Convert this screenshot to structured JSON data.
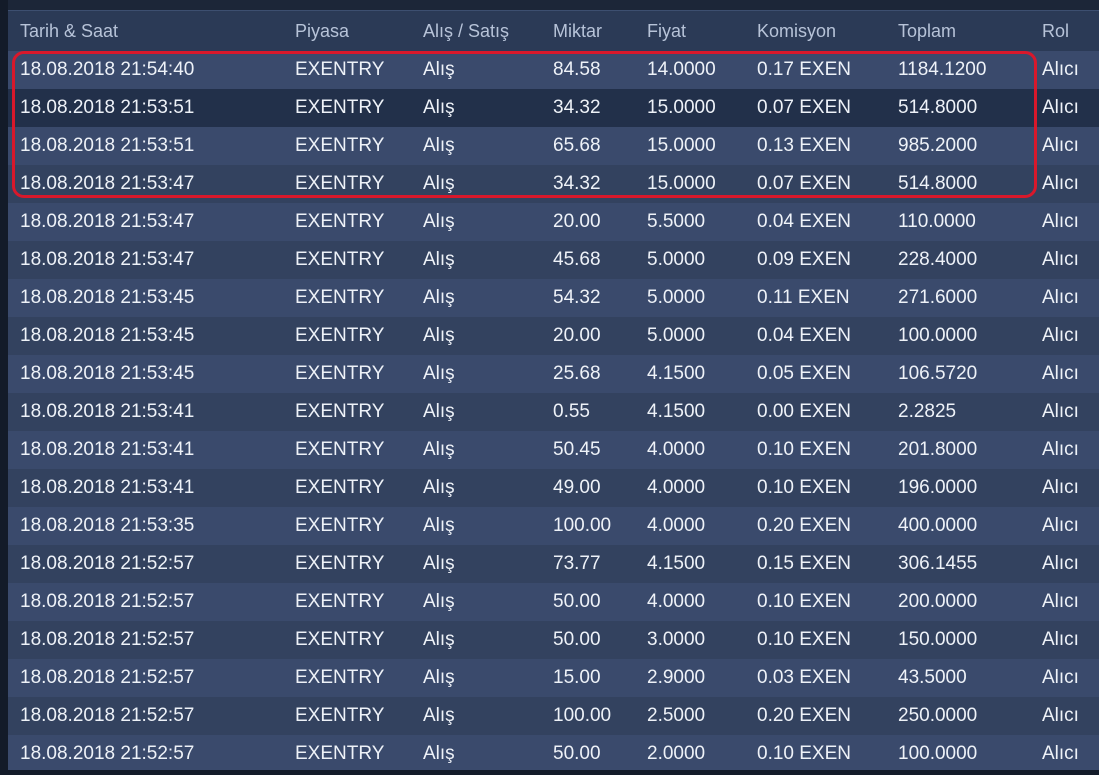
{
  "table": {
    "headers": {
      "date": "Tarih & Saat",
      "market": "Piyasa",
      "side": "Alış / Satış",
      "amount": "Miktar",
      "price": "Fiyat",
      "fee": "Komisyon",
      "total": "Toplam",
      "role": "Rol"
    },
    "rows": [
      {
        "date": "18.08.2018 21:54:40",
        "market": "EXENTRY",
        "side": "Alış",
        "amount": "84.58",
        "price": "14.0000",
        "fee": "0.17 EXEN",
        "total": "1184.1200",
        "role": "Alıcı"
      },
      {
        "date": "18.08.2018 21:53:51",
        "market": "EXENTRY",
        "side": "Alış",
        "amount": "34.32",
        "price": "15.0000",
        "fee": "0.07 EXEN",
        "total": "514.8000",
        "role": "Alıcı"
      },
      {
        "date": "18.08.2018 21:53:51",
        "market": "EXENTRY",
        "side": "Alış",
        "amount": "65.68",
        "price": "15.0000",
        "fee": "0.13 EXEN",
        "total": "985.2000",
        "role": "Alıcı"
      },
      {
        "date": "18.08.2018 21:53:47",
        "market": "EXENTRY",
        "side": "Alış",
        "amount": "34.32",
        "price": "15.0000",
        "fee": "0.07 EXEN",
        "total": "514.8000",
        "role": "Alıcı"
      },
      {
        "date": "18.08.2018 21:53:47",
        "market": "EXENTRY",
        "side": "Alış",
        "amount": "20.00",
        "price": "5.5000",
        "fee": "0.04 EXEN",
        "total": "110.0000",
        "role": "Alıcı"
      },
      {
        "date": "18.08.2018 21:53:47",
        "market": "EXENTRY",
        "side": "Alış",
        "amount": "45.68",
        "price": "5.0000",
        "fee": "0.09 EXEN",
        "total": "228.4000",
        "role": "Alıcı"
      },
      {
        "date": "18.08.2018 21:53:45",
        "market": "EXENTRY",
        "side": "Alış",
        "amount": "54.32",
        "price": "5.0000",
        "fee": "0.11 EXEN",
        "total": "271.6000",
        "role": "Alıcı"
      },
      {
        "date": "18.08.2018 21:53:45",
        "market": "EXENTRY",
        "side": "Alış",
        "amount": "20.00",
        "price": "5.0000",
        "fee": "0.04 EXEN",
        "total": "100.0000",
        "role": "Alıcı"
      },
      {
        "date": "18.08.2018 21:53:45",
        "market": "EXENTRY",
        "side": "Alış",
        "amount": "25.68",
        "price": "4.1500",
        "fee": "0.05 EXEN",
        "total": "106.5720",
        "role": "Alıcı"
      },
      {
        "date": "18.08.2018 21:53:41",
        "market": "EXENTRY",
        "side": "Alış",
        "amount": "0.55",
        "price": "4.1500",
        "fee": "0.00 EXEN",
        "total": "2.2825",
        "role": "Alıcı"
      },
      {
        "date": "18.08.2018 21:53:41",
        "market": "EXENTRY",
        "side": "Alış",
        "amount": "50.45",
        "price": "4.0000",
        "fee": "0.10 EXEN",
        "total": "201.8000",
        "role": "Alıcı"
      },
      {
        "date": "18.08.2018 21:53:41",
        "market": "EXENTRY",
        "side": "Alış",
        "amount": "49.00",
        "price": "4.0000",
        "fee": "0.10 EXEN",
        "total": "196.0000",
        "role": "Alıcı"
      },
      {
        "date": "18.08.2018 21:53:35",
        "market": "EXENTRY",
        "side": "Alış",
        "amount": "100.00",
        "price": "4.0000",
        "fee": "0.20 EXEN",
        "total": "400.0000",
        "role": "Alıcı"
      },
      {
        "date": "18.08.2018 21:52:57",
        "market": "EXENTRY",
        "side": "Alış",
        "amount": "73.77",
        "price": "4.1500",
        "fee": "0.15 EXEN",
        "total": "306.1455",
        "role": "Alıcı"
      },
      {
        "date": "18.08.2018 21:52:57",
        "market": "EXENTRY",
        "side": "Alış",
        "amount": "50.00",
        "price": "4.0000",
        "fee": "0.10 EXEN",
        "total": "200.0000",
        "role": "Alıcı"
      },
      {
        "date": "18.08.2018 21:52:57",
        "market": "EXENTRY",
        "side": "Alış",
        "amount": "50.00",
        "price": "3.0000",
        "fee": "0.10 EXEN",
        "total": "150.0000",
        "role": "Alıcı"
      },
      {
        "date": "18.08.2018 21:52:57",
        "market": "EXENTRY",
        "side": "Alış",
        "amount": "15.00",
        "price": "2.9000",
        "fee": "0.03 EXEN",
        "total": "43.5000",
        "role": "Alıcı"
      },
      {
        "date": "18.08.2018 21:52:57",
        "market": "EXENTRY",
        "side": "Alış",
        "amount": "100.00",
        "price": "2.5000",
        "fee": "0.20 EXEN",
        "total": "250.0000",
        "role": "Alıcı"
      },
      {
        "date": "18.08.2018 21:52:57",
        "market": "EXENTRY",
        "side": "Alış",
        "amount": "50.00",
        "price": "2.0000",
        "fee": "0.10 EXEN",
        "total": "100.0000",
        "role": "Alıcı"
      }
    ],
    "selected_row_index": 1
  },
  "colors": {
    "background": "#1c2638",
    "header": "#2b3a56",
    "row_odd": "#3a4a6c",
    "row_even": "#33425f",
    "row_selected": "#22304a",
    "highlight": "#d9182b"
  }
}
